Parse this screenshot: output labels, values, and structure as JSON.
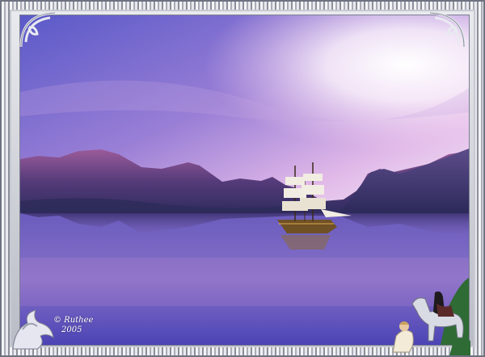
{
  "signature": {
    "name": "© Ruthee",
    "year": "2005"
  },
  "colors": {
    "sky_top": "#5a59c8",
    "sky_mid": "#c48ad6",
    "sky_glow": "#fbf5fb",
    "mountains": "#3b2f66",
    "water_top": "#6b5fbf",
    "water_bottom": "#4b44b6",
    "frame_silver": "#b9bcc6"
  },
  "icons": [
    "ornament-corner-icon",
    "griffin-icon",
    "horse-rider-icon",
    "sailing-ship-icon"
  ]
}
